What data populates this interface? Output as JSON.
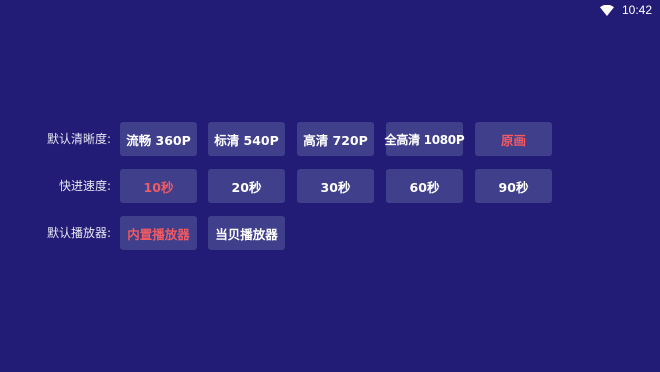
{
  "status": {
    "time": "10:42"
  },
  "rows": [
    {
      "label": "默认清晰度:",
      "options": [
        {
          "label": "流畅 360P",
          "selected": false
        },
        {
          "label": "标清 540P",
          "selected": false
        },
        {
          "label": "高清 720P",
          "selected": false
        },
        {
          "label": "全高清 1080P",
          "selected": false
        },
        {
          "label": "原画",
          "selected": true
        }
      ]
    },
    {
      "label": "快进速度:",
      "options": [
        {
          "label": "10秒",
          "selected": true
        },
        {
          "label": "20秒",
          "selected": false
        },
        {
          "label": "30秒",
          "selected": false
        },
        {
          "label": "60秒",
          "selected": false
        },
        {
          "label": "90秒",
          "selected": false
        }
      ]
    },
    {
      "label": "默认播放器:",
      "options": [
        {
          "label": "内置播放器",
          "selected": true
        },
        {
          "label": "当贝播放器",
          "selected": false
        }
      ]
    }
  ],
  "colors": {
    "background": "#221c76",
    "option_bg": "#403f8c",
    "selected_text": "#ef5a63"
  }
}
